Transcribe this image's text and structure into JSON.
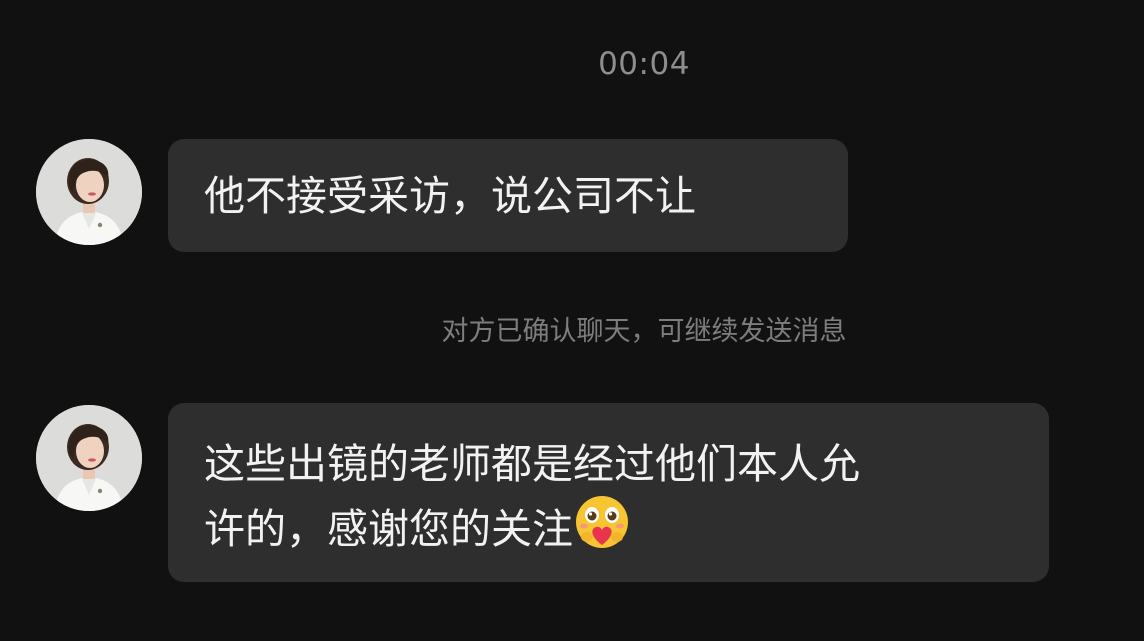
{
  "chat": {
    "timestamp": "00:04",
    "system_note": "对方已确认聊天，可继续发送消息",
    "messages": [
      {
        "sender": "other",
        "avatar_icon": "woman-portrait-avatar",
        "text": "他不接受采访，说公司不让"
      },
      {
        "sender": "other",
        "avatar_icon": "woman-portrait-avatar",
        "line1": "这些出镜的老师都是经过他们本人允",
        "line2": "许的，感谢您的关注",
        "emoji_icon": "heart-hug-emoji"
      }
    ]
  },
  "colors": {
    "background": "#111111",
    "bubble": "#2e2e2e",
    "message_text": "#f2f2f2",
    "meta_text": "#8e8e8e"
  }
}
